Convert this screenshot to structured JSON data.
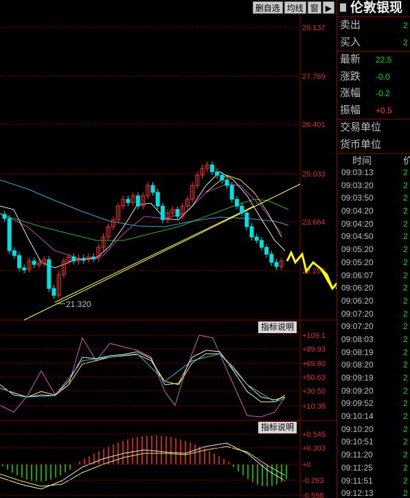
{
  "toolbar": {
    "delete_label": "删自选",
    "avgline_label": "均线",
    "window_label": "窗",
    "arrow_icon": "right-arrow-icon"
  },
  "price_axis": [
    "29.137",
    "27.769",
    "26.401",
    "25.033",
    "23.664",
    "22.296"
  ],
  "low_marker": "21.320",
  "indicator_label_1": "指标说明",
  "indicator_label_2": "指标说明",
  "kdj_axis": [
    "+109.1",
    "+89.93",
    "+69.80",
    "+50.63",
    "+30.50",
    "+10.38"
  ],
  "macd_axis": [
    "+0.545",
    "+0.303",
    "+0",
    "-0.293",
    "-0.598"
  ],
  "panel": {
    "title": "伦敦银现",
    "sell": "卖出",
    "sell_val": "2",
    "buy": "买入",
    "buy_val": "2",
    "latest": "最新",
    "latest_val": "22.5",
    "change": "涨跌",
    "change_val": "-0.0",
    "pct": "涨幅",
    "pct_val": "-0.2",
    "amp": "振幅",
    "amp_val": "+0.5",
    "unit": "交易单位",
    "currency": "货币单位",
    "time_header": "时间",
    "price_header": "价"
  },
  "trades": [
    {
      "time": "09:03:13",
      "v": "2"
    },
    {
      "time": "09:03:20",
      "v": "2"
    },
    {
      "time": "09:03:50",
      "v": "2"
    },
    {
      "time": "09:04:20",
      "v": "2"
    },
    {
      "time": "09:04:20",
      "v": "2"
    },
    {
      "time": "09:04:50",
      "v": "2"
    },
    {
      "time": "09:05:20",
      "v": "2"
    },
    {
      "time": "09:05:20",
      "v": "2"
    },
    {
      "time": "09:06:07",
      "v": "2"
    },
    {
      "time": "09:06:20",
      "v": "2"
    },
    {
      "time": "09:06:20",
      "v": "2"
    },
    {
      "time": "09:07:20",
      "v": "2"
    },
    {
      "time": "09:07:20",
      "v": "2"
    },
    {
      "time": "09:08:03",
      "v": "2"
    },
    {
      "time": "09:08:19",
      "v": "2"
    },
    {
      "time": "09:08:20",
      "v": "2"
    },
    {
      "time": "09:09:19",
      "v": "2"
    },
    {
      "time": "09:09:20",
      "v": "2"
    },
    {
      "time": "09:09:52",
      "v": "2"
    },
    {
      "time": "09:10:14",
      "v": "2"
    },
    {
      "time": "09:10:20",
      "v": "2"
    },
    {
      "time": "09:10:51",
      "v": "2"
    },
    {
      "time": "09:11:20",
      "v": "2"
    },
    {
      "time": "09:11:25",
      "v": "2"
    },
    {
      "time": "09:11:51",
      "v": "2"
    },
    {
      "time": "09:12:13",
      "v": "2"
    }
  ],
  "colors": {
    "up": "#ff3030",
    "down": "#00e0e0",
    "grid": "#8b0000",
    "trend": "#ffff66",
    "arrow": "#ffff00"
  }
}
